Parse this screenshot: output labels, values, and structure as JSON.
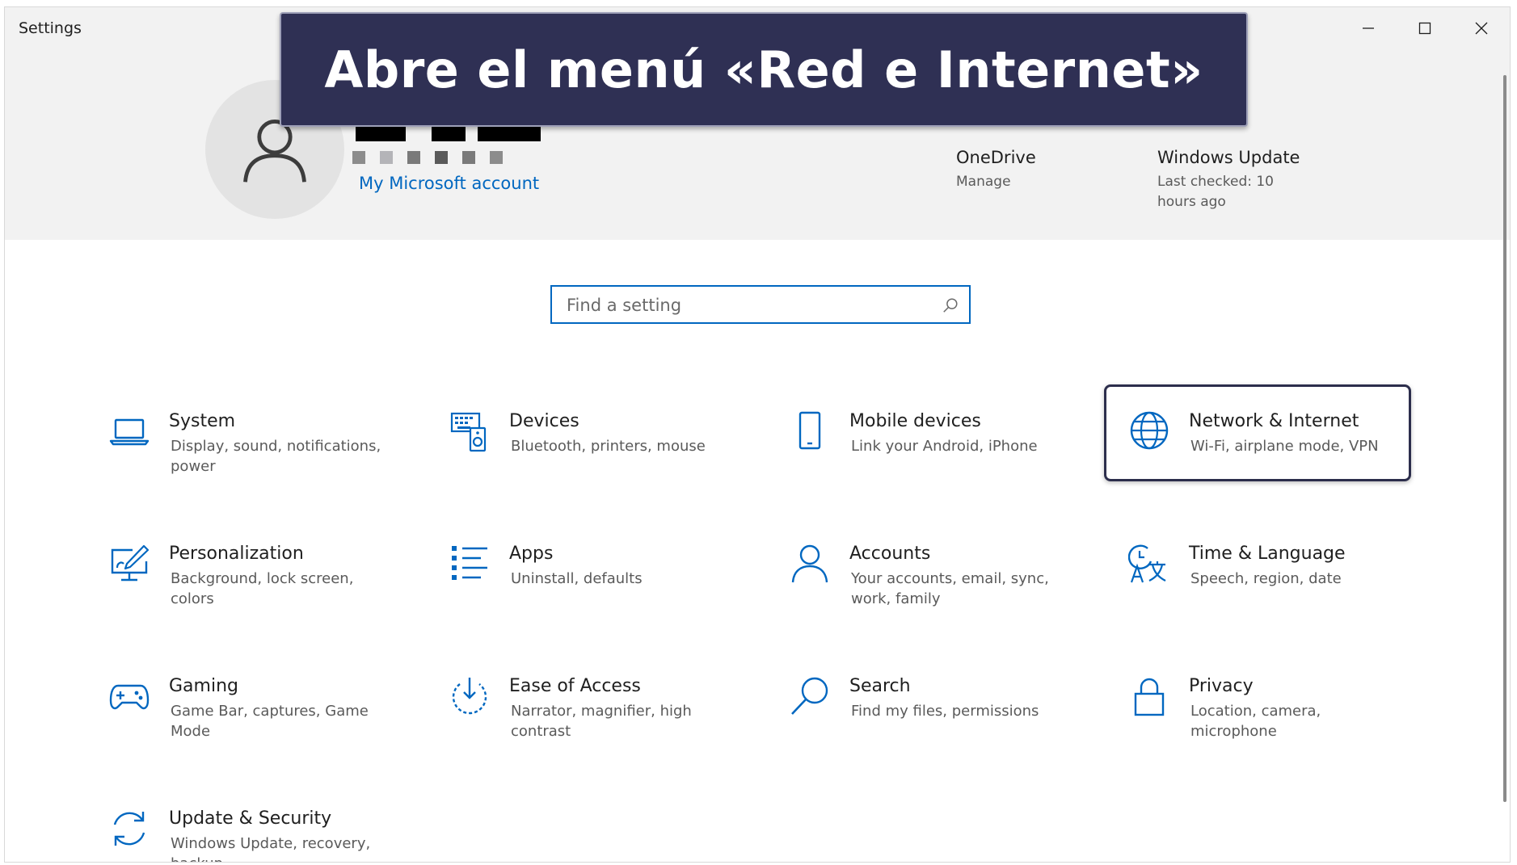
{
  "window": {
    "title": "Settings"
  },
  "banner": {
    "text": "Abre el menú «Red e Internet»"
  },
  "account": {
    "link": "My Microsoft account"
  },
  "header_items": [
    {
      "title": "OneDrive",
      "subtitle": "Manage"
    },
    {
      "title": "Windows Update",
      "subtitle_line1": "Last checked: 10",
      "subtitle_line2": "hours ago"
    }
  ],
  "search": {
    "placeholder": "Find a setting",
    "value": ""
  },
  "tiles": [
    {
      "icon": "laptop-icon",
      "title": "System",
      "subtitle": "Display, sound, notifications, power"
    },
    {
      "icon": "keyboard-speaker-icon",
      "title": "Devices",
      "subtitle": "Bluetooth, printers, mouse"
    },
    {
      "icon": "phone-icon",
      "title": "Mobile devices",
      "subtitle": "Link your Android, iPhone"
    },
    {
      "icon": "globe-icon",
      "title": "Network & Internet",
      "subtitle": "Wi-Fi, airplane mode, VPN"
    },
    {
      "icon": "paint-monitor-icon",
      "title": "Personalization",
      "subtitle": "Background, lock screen, colors"
    },
    {
      "icon": "list-icon",
      "title": "Apps",
      "subtitle": "Uninstall, defaults"
    },
    {
      "icon": "person-icon",
      "title": "Accounts",
      "subtitle": "Your accounts, email, sync, work, family"
    },
    {
      "icon": "clock-language-icon",
      "title": "Time & Language",
      "subtitle": "Speech, region, date"
    },
    {
      "icon": "gamepad-icon",
      "title": "Gaming",
      "subtitle": "Game Bar, captures, Game Mode"
    },
    {
      "icon": "ease-of-access-icon",
      "title": "Ease of Access",
      "subtitle": "Narrator, magnifier, high contrast"
    },
    {
      "icon": "magnifier-icon",
      "title": "Search",
      "subtitle": "Find my files, permissions"
    },
    {
      "icon": "lock-icon",
      "title": "Privacy",
      "subtitle": "Location, camera, microphone"
    },
    {
      "icon": "sync-icon",
      "title": "Update & Security",
      "subtitle": "Windows Update, recovery, backup"
    }
  ],
  "colors": {
    "accent": "#0067c0",
    "banner_bg": "#2f3054",
    "header_bg": "#f2f2f2",
    "highlight_border": "#2c2e4c"
  }
}
